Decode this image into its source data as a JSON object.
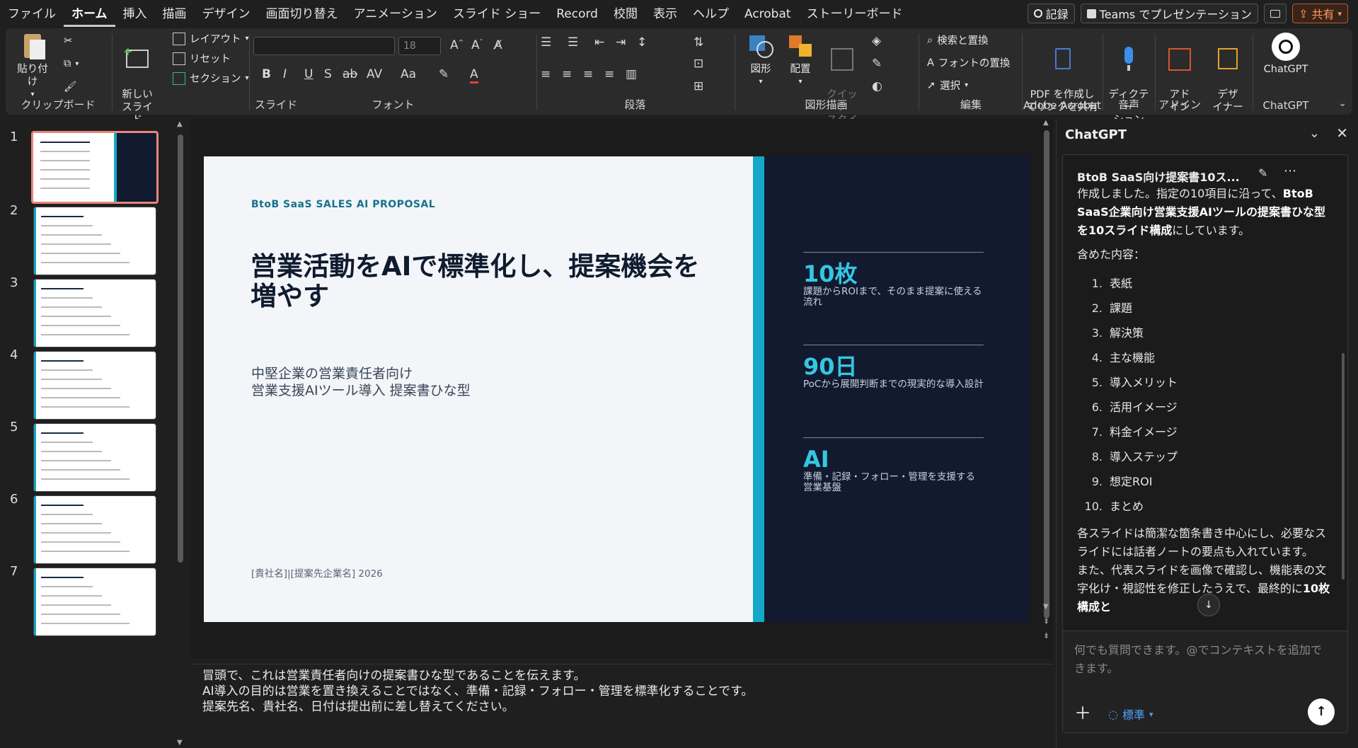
{
  "menubar": {
    "items": [
      "ファイル",
      "ホーム",
      "挿入",
      "描画",
      "デザイン",
      "画面切り替え",
      "アニメーション",
      "スライド ショー",
      "Record",
      "校閲",
      "表示",
      "ヘルプ",
      "Acrobat",
      "ストーリーボード"
    ],
    "active": "ホーム",
    "record_btn": "記録",
    "teams_btn": "Teams でプレゼンテーション",
    "share_btn": "共有"
  },
  "ribbon": {
    "clipboard": {
      "paste": "貼り付け",
      "label": "クリップボード"
    },
    "slides": {
      "new_slide": "新しい\nスライド",
      "layout": "レイアウト",
      "reset": "リセット",
      "section": "セクション",
      "label": "スライド"
    },
    "font": {
      "size": "18",
      "label": "フォント"
    },
    "paragraph": {
      "label": "段落"
    },
    "drawing": {
      "shapes": "図形",
      "arrange": "配置",
      "quick_style": "クイック\nスタイル",
      "label": "図形描画"
    },
    "editing": {
      "find": "検索と置換",
      "replace_font": "フォントの置換",
      "select": "選択",
      "label": "編集"
    },
    "acrobat": {
      "pdf": "PDF を作成し\nてリンクを共有",
      "label": "Adobe Acrobat"
    },
    "voice": {
      "dictate": "ディクテー\nション",
      "label": "音声"
    },
    "addin": {
      "addin": "アド\nイン",
      "label": "アドイン"
    },
    "designer": {
      "designer": "デザ\nイナー"
    },
    "chatgpt": {
      "btn": "ChatGPT",
      "label": "ChatGPT"
    }
  },
  "thumbnails": [
    "1",
    "2",
    "3",
    "4",
    "5",
    "6",
    "7"
  ],
  "slide": {
    "eyebrow": "BtoB SaaS SALES AI PROPOSAL",
    "title": "営業活動をAIで標準化し、提案機会を増やす",
    "subtitle_line1": "中堅企業の営業責任者向け",
    "subtitle_line2": "営業支援AIツール導入 提案書ひな型",
    "footer": "[貴社名]|[提案先企業名] 2026",
    "stats": [
      {
        "value": "10枚",
        "desc": "課題からROIまで、そのまま提案に使える流れ"
      },
      {
        "value": "90日",
        "desc": "PoCから展開判断までの現実的な導入設計"
      },
      {
        "value": "AI",
        "desc": "準備・記録・フォロー・管理を支援する営業基盤"
      }
    ]
  },
  "notes": [
    "冒頭で、これは営業責任者向けの提案書ひな型であることを伝えます。",
    "AI導入の目的は営業を置き換えることではなく、準備・記録・フォロー・管理を標準化することです。",
    "提案先名、貴社名、日付は提出前に差し替えてください。"
  ],
  "chatpane": {
    "header": "ChatGPT",
    "chat_title": "BtoB SaaS向け提案書10ス...",
    "intro_a": "作成しました。指定の10項目に沿って、",
    "intro_b": "BtoB SaaS企業向け営業支援AIツールの提案書ひな型を10スライド構成",
    "intro_c": "にしています。",
    "contents_label": "含めた内容：",
    "items": [
      "表紙",
      "課題",
      "解決策",
      "主な機能",
      "導入メリット",
      "活用イメージ",
      "料金イメージ",
      "導入ステップ",
      "想定ROI",
      "まとめ"
    ],
    "para1": "各スライドは簡潔な箇条書き中心にし、必要なスライドには話者ノートの要点も入れています。",
    "para2_a": "また、代表スライドを画像で確認し、機能表の文字化け・視認性を修正したうえで、最終的に",
    "para2_b": "10枚構成と",
    "placeholder": "何でも質問できます。@でコンテキストを追加できます。",
    "mode": "標準"
  },
  "colors": {
    "accent": "#14a8c8",
    "dark_panel": "#111a2f",
    "share": "#ff9b5e"
  }
}
